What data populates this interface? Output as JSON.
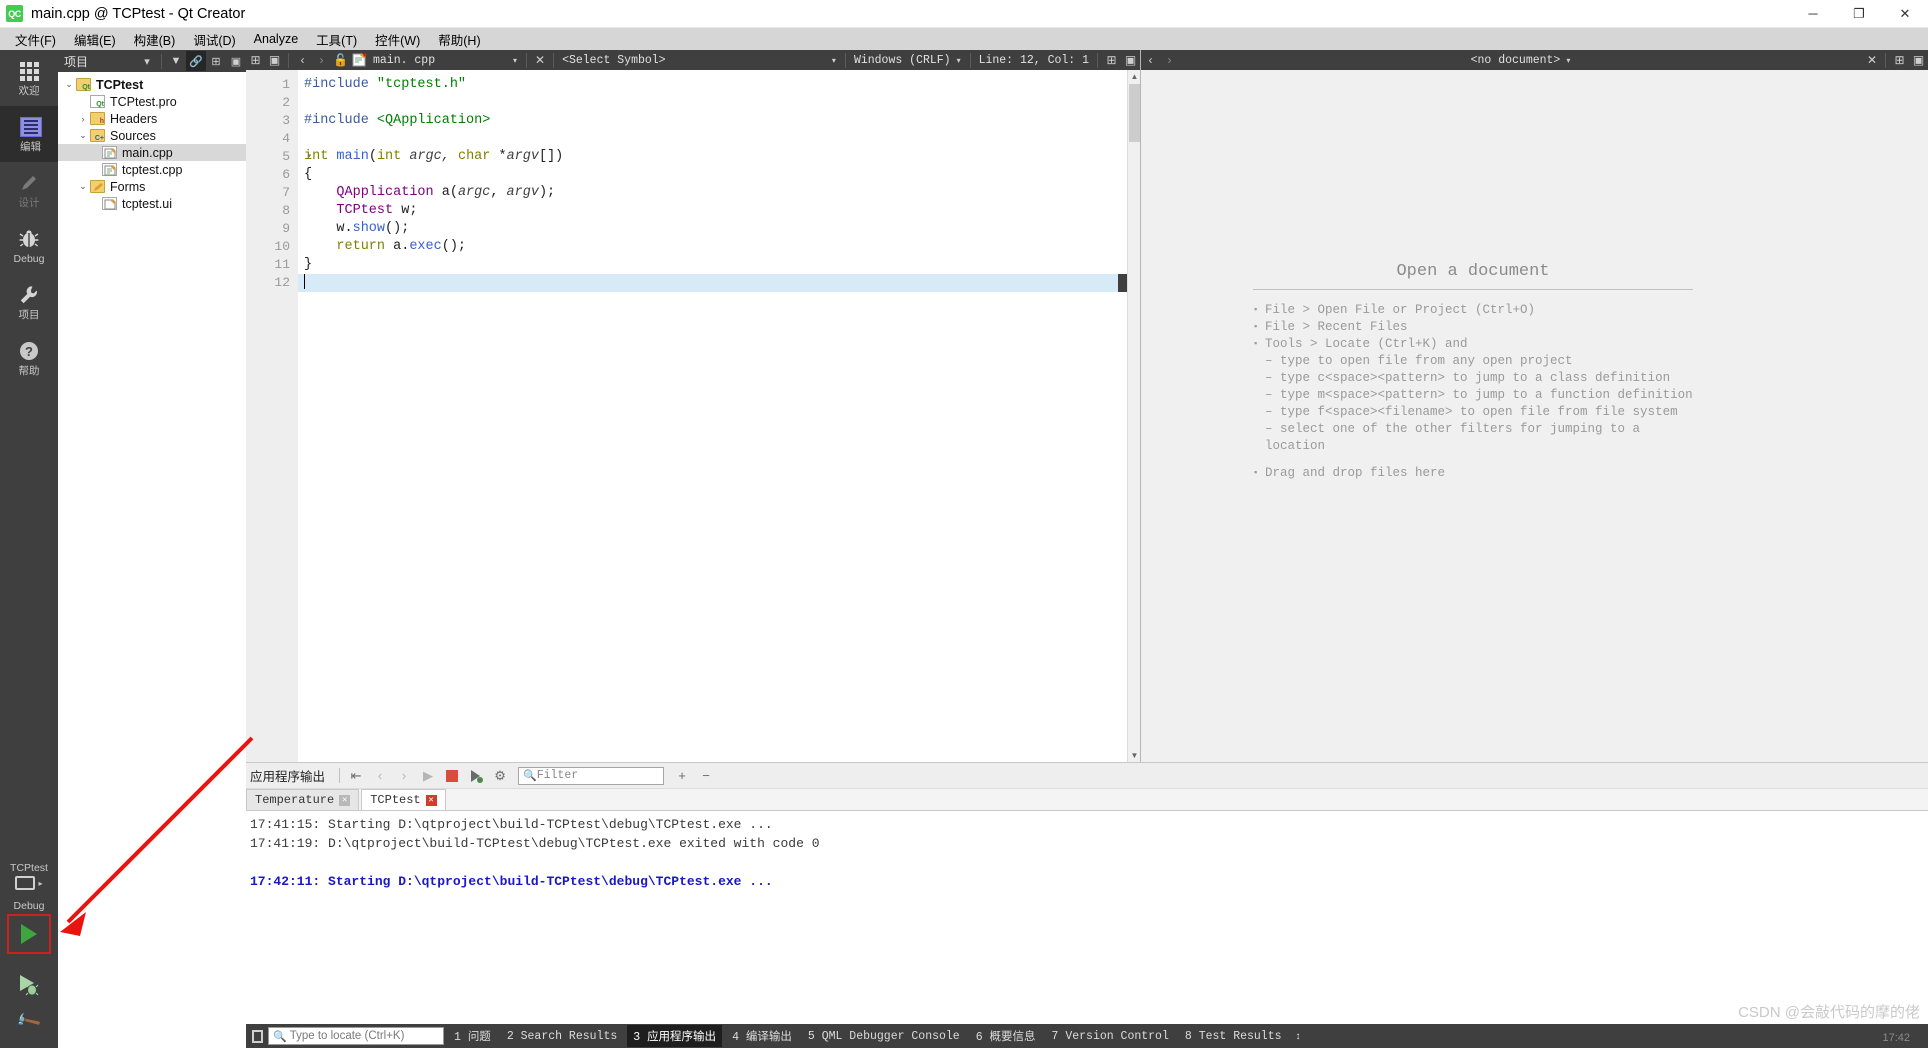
{
  "window": {
    "title": "main.cpp @ TCPtest - Qt Creator",
    "logo_text": "QC",
    "minimize": "─",
    "maximize": "❐",
    "close": "✕"
  },
  "menubar": [
    {
      "label": "文件(F)",
      "mn": "F"
    },
    {
      "label": "编辑(E)",
      "mn": "E"
    },
    {
      "label": "构建(B)",
      "mn": "B"
    },
    {
      "label": "调试(D)",
      "mn": "D"
    },
    {
      "label": "Analyze",
      "mn": "A"
    },
    {
      "label": "工具(T)",
      "mn": "T"
    },
    {
      "label": "控件(W)",
      "mn": "W"
    },
    {
      "label": "帮助(H)",
      "mn": "H"
    }
  ],
  "modebar": {
    "items": [
      {
        "label": "欢迎",
        "icon": "grid-icon",
        "state": "normal"
      },
      {
        "label": "编辑",
        "icon": "edit-document-icon",
        "state": "active"
      },
      {
        "label": "设计",
        "icon": "pencil-icon",
        "state": "disabled"
      },
      {
        "label": "Debug",
        "icon": "bug-icon",
        "state": "normal"
      },
      {
        "label": "项目",
        "icon": "wrench-icon",
        "state": "normal"
      },
      {
        "label": "帮助",
        "icon": "question-circle-icon",
        "state": "normal"
      }
    ],
    "kit_project": "TCPtest",
    "kit_config": "Debug",
    "run_icon": "run-play-icon",
    "debug_icon": "debug-run-icon",
    "build_icon": "hammer-build-icon"
  },
  "project_panel": {
    "title": "项目",
    "header_icons": [
      "chevron-down-icon",
      "filter-icon",
      "link-sync-icon",
      "split-add-icon",
      "collapse-icon"
    ],
    "tree": [
      {
        "depth": 0,
        "arrow": "⌄",
        "label": "TCPtest",
        "icon": "qt-project-icon",
        "bold": true,
        "selected": false
      },
      {
        "depth": 1,
        "arrow": "",
        "label": "TCPtest.pro",
        "icon": "qt-pro-file-icon",
        "bold": false,
        "selected": false
      },
      {
        "depth": 1,
        "arrow": "›",
        "label": "Headers",
        "icon": "headers-folder-icon",
        "bold": false,
        "selected": false
      },
      {
        "depth": 1,
        "arrow": "⌄",
        "label": "Sources",
        "icon": "sources-folder-icon",
        "bold": false,
        "selected": false
      },
      {
        "depth": 2,
        "arrow": "",
        "label": "main.cpp",
        "icon": "cpp-file-icon",
        "bold": false,
        "selected": true
      },
      {
        "depth": 2,
        "arrow": "",
        "label": "tcptest.cpp",
        "icon": "cpp-file-icon",
        "bold": false,
        "selected": false
      },
      {
        "depth": 1,
        "arrow": "⌄",
        "label": "Forms",
        "icon": "forms-folder-icon",
        "bold": false,
        "selected": false
      },
      {
        "depth": 2,
        "arrow": "",
        "label": "tcptest.ui",
        "icon": "ui-file-icon",
        "bold": false,
        "selected": false
      }
    ]
  },
  "editor_toolbar": {
    "file_name": "main. cpp",
    "symbol_selector": "<Select Symbol>",
    "line_ending": "Windows (CRLF)",
    "cursor_position": "Line: 12, Col: 1",
    "close_icon": "✕",
    "back_icon": "‹",
    "forward_icon": "›",
    "lock_icon": "unlock-icon",
    "split_icon": "split-horizontal-icon",
    "split_side_icon": "split-side-icon",
    "doc_icon": "document-edit-icon"
  },
  "doc_toolbar": {
    "placeholder": "<no document>",
    "back_icon": "‹",
    "forward_icon": "›",
    "close_icon": "✕",
    "split_icon": "split-horizontal-icon",
    "unsplit_icon": "unsplit-icon"
  },
  "code": {
    "lines": [
      {
        "n": 1,
        "fold": false,
        "current": false
      },
      {
        "n": 2,
        "fold": false,
        "current": false
      },
      {
        "n": 3,
        "fold": false,
        "current": false
      },
      {
        "n": 4,
        "fold": false,
        "current": false
      },
      {
        "n": 5,
        "fold": true,
        "current": false
      },
      {
        "n": 6,
        "fold": false,
        "current": false
      },
      {
        "n": 7,
        "fold": false,
        "current": false
      },
      {
        "n": 8,
        "fold": false,
        "current": false
      },
      {
        "n": 9,
        "fold": false,
        "current": false
      },
      {
        "n": 10,
        "fold": false,
        "current": false
      },
      {
        "n": 11,
        "fold": false,
        "current": false
      },
      {
        "n": 12,
        "fold": false,
        "current": true
      }
    ],
    "text": {
      "l1a": "#include ",
      "l1b": "\"tcptest.h\"",
      "l3a": "#include ",
      "l3b": "<QApplication>",
      "l5a": "int",
      "l5b": " ",
      "l5c": "main",
      "l5d": "(",
      "l5e": "int",
      "l5f": " argc, ",
      "l5g": "char",
      "l5h": " *",
      "l5i": "argv",
      "l5j": "[])",
      "l6": "{",
      "l7a": "    ",
      "l7b": "QApplication",
      "l7c": " a(",
      "l7d": "argc",
      "l7e": ", ",
      "l7f": "argv",
      "l7g": ");",
      "l8a": "    ",
      "l8b": "TCPtest",
      "l8c": " w;",
      "l9a": "    w.",
      "l9b": "show",
      "l9c": "();",
      "l10a": "    ",
      "l10b": "return",
      "l10c": " a.",
      "l10d": "exec",
      "l10e": "();",
      "l11": "}"
    }
  },
  "open_document": {
    "title": "Open a document",
    "items": [
      {
        "bullet": true,
        "text": "File > Open File or Project (Ctrl+O)"
      },
      {
        "bullet": true,
        "text": "File > Recent Files"
      },
      {
        "bullet": true,
        "text": "Tools > Locate (Ctrl+K) and"
      },
      {
        "bullet": false,
        "text": "– type to open file from any open project"
      },
      {
        "bullet": false,
        "text": "– type c<space><pattern> to jump to a class definition"
      },
      {
        "bullet": false,
        "text": "– type m<space><pattern> to jump to a function definition"
      },
      {
        "bullet": false,
        "text": "– type f<space><filename> to open file from file system"
      },
      {
        "bullet": false,
        "text": "– select one of the other filters for jumping to a location"
      },
      {
        "bullet": true,
        "text": "Drag and drop files here"
      }
    ]
  },
  "output_pane": {
    "title": "应用程序输出",
    "toolbar_icons": [
      "word-wrap-icon",
      "prev-item-icon",
      "next-item-icon",
      "run-icon",
      "stop-icon",
      "attach-debugger-icon",
      "settings-gear-icon"
    ],
    "filter_placeholder": "Filter",
    "zoom_in": "+",
    "zoom_out": "−",
    "tabs": [
      {
        "label": "Temperature",
        "active": false,
        "close_state": "gray"
      },
      {
        "label": "TCPtest",
        "active": true,
        "close_state": "red"
      }
    ],
    "lines": [
      {
        "text": "17:41:15: Starting D:\\qtproject\\build-TCPtest\\debug\\TCPtest.exe ...",
        "style": "normal"
      },
      {
        "text": "17:41:19: D:\\qtproject\\build-TCPtest\\debug\\TCPtest.exe exited with code 0",
        "style": "normal"
      },
      {
        "text": "",
        "style": "normal"
      },
      {
        "text": "17:42:11: Starting D:\\qtproject\\build-TCPtest\\debug\\TCPtest.exe ...",
        "style": "blue"
      }
    ]
  },
  "statusbar": {
    "toggle_icon": "toggle-sidebar-icon",
    "locate_placeholder": "Type to locate (Ctrl+K)",
    "items": [
      {
        "num": "1",
        "label": "问题",
        "active": false
      },
      {
        "num": "2",
        "label": "Search Results",
        "active": false
      },
      {
        "num": "3",
        "label": "应用程序输出",
        "active": true
      },
      {
        "num": "4",
        "label": "编译输出",
        "active": false
      },
      {
        "num": "5",
        "label": "QML Debugger Console",
        "active": false
      },
      {
        "num": "6",
        "label": "概要信息",
        "active": false
      },
      {
        "num": "7",
        "label": "Version Control",
        "active": false
      },
      {
        "num": "8",
        "label": "Test Results",
        "active": false
      }
    ],
    "updown": "↕"
  },
  "watermark": {
    "main": "CSDN @会敲代码的摩的佬",
    "sub": "17:42"
  },
  "colors": {
    "accent_green": "#41cd52",
    "dark_chrome": "#3f3f3f",
    "selection_blue": "#d6eaf8",
    "string_green": "#008000",
    "keyword_olive": "#808000",
    "class_purple": "#800080",
    "function_blue": "#3a5fcd",
    "output_blue": "#1818c8",
    "annotation_red": "#e8140f"
  }
}
